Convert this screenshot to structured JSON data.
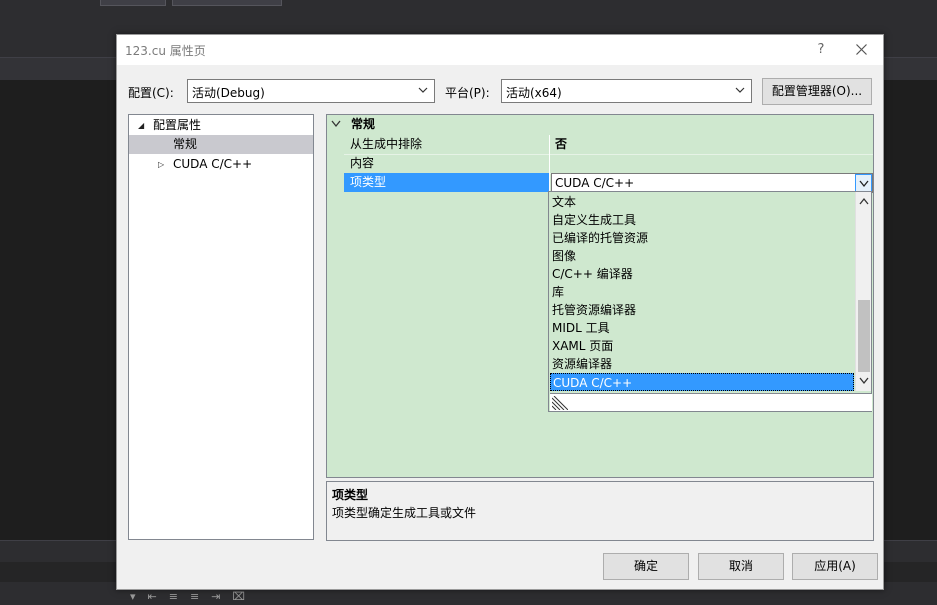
{
  "dialog": {
    "title": "123.cu 属性页",
    "help_label": "?",
    "config_label": "配置(C):",
    "config_value": "活动(Debug)",
    "platform_label": "平台(P):",
    "platform_value": "活动(x64)",
    "config_manager_label": "配置管理器(O)..."
  },
  "tree": {
    "root": "配置属性",
    "items": [
      "常规",
      "CUDA C/C++"
    ]
  },
  "grid": {
    "category": "常规",
    "rows": [
      {
        "name": "从生成中排除",
        "value": "否"
      },
      {
        "name": "内容",
        "value": ""
      },
      {
        "name": "项类型",
        "value": "CUDA C/C++"
      }
    ]
  },
  "dropdown": {
    "options": [
      "文本",
      "自定义生成工具",
      "已编译的托管资源",
      "图像",
      "C/C++ 编译器",
      "库",
      "托管资源编译器",
      "MIDL 工具",
      "XAML 页面",
      "资源编译器",
      "CUDA C/C++"
    ],
    "selected_index": 10
  },
  "description": {
    "title": "项类型",
    "text": "项类型确定生成工具或文件"
  },
  "buttons": {
    "ok": "确定",
    "cancel": "取消",
    "apply": "应用(A)"
  },
  "colors": {
    "accent": "#3399ff",
    "grid_bg": "#cfe8cf",
    "ide_bg": "#2d2d30"
  }
}
